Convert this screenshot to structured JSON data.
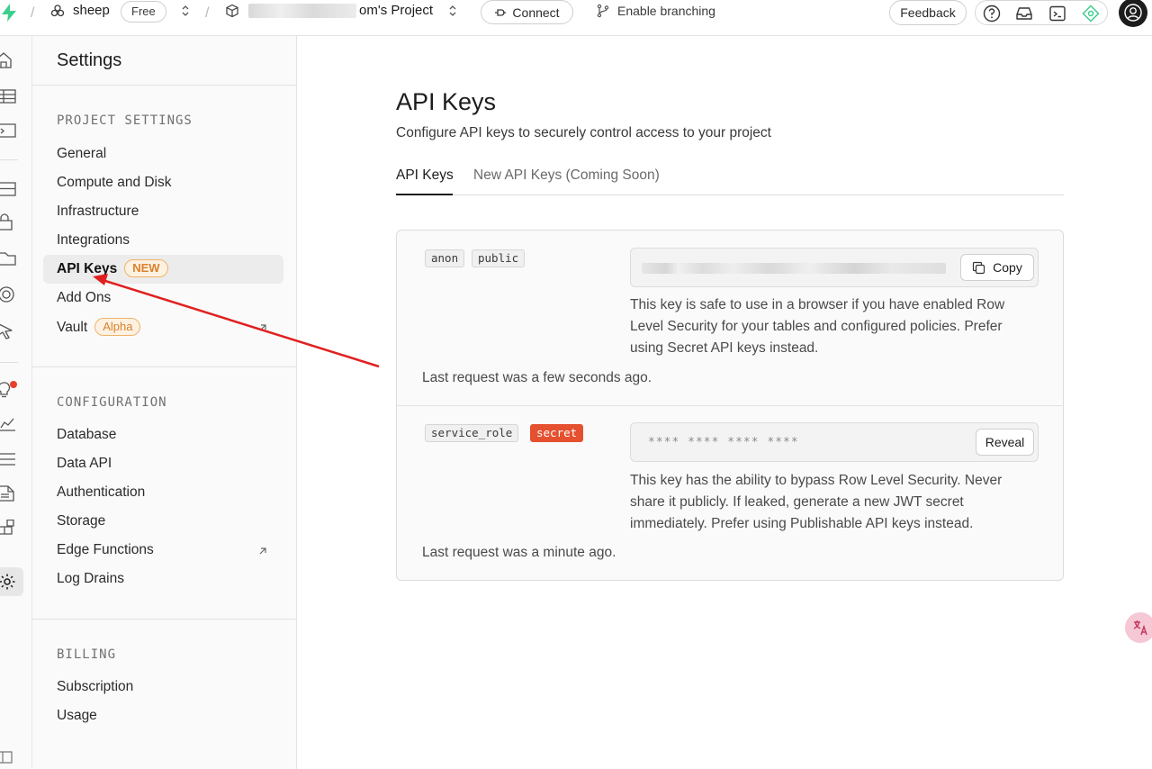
{
  "topbar": {
    "org_name": "sheep",
    "plan": "Free",
    "project_name": "om's Project",
    "connect_label": "Connect",
    "branching_label": "Enable branching",
    "feedback_label": "Feedback",
    "separator": "/"
  },
  "sidebar": {
    "title": "Settings",
    "sections": [
      {
        "heading": "PROJECT SETTINGS",
        "items": [
          "General",
          "Compute and Disk",
          "Infrastructure",
          "Integrations",
          "API Keys",
          "Add Ons",
          "Vault"
        ]
      },
      {
        "heading": "CONFIGURATION",
        "items": [
          "Database",
          "Data API",
          "Authentication",
          "Storage",
          "Edge Functions",
          "Log Drains"
        ]
      },
      {
        "heading": "BILLING",
        "items": [
          "Subscription",
          "Usage"
        ]
      }
    ],
    "badge_new": "NEW",
    "badge_alpha": "Alpha"
  },
  "main": {
    "title": "API Keys",
    "subtitle": "Configure API keys to securely control access to your project",
    "tabs": [
      "API Keys",
      "New API Keys (Coming Soon)"
    ],
    "keys": [
      {
        "tags": [
          "anon",
          "public"
        ],
        "button": "Copy",
        "description": "This key is safe to use in a browser if you have enabled Row Level Security for your tables and configured policies. Prefer using Secret API keys instead.",
        "last_request": "Last request was a few seconds ago."
      },
      {
        "tags": [
          "service_role",
          "secret"
        ],
        "masked_value": "**** **** **** ****",
        "button": "Reveal",
        "description": "This key has the ability to bypass Row Level Security. Never share it publicly. If leaked, generate a new JWT secret immediately. Prefer using Publishable API keys instead.",
        "last_request": "Last request was a minute ago."
      }
    ]
  },
  "colors": {
    "brand": "#3ecf8e",
    "secret_tag": "#e5502f",
    "annotation_arrow": "#e02020",
    "badge_orange": "#d9822b"
  },
  "icons": [
    "supabase-logo-icon",
    "org-icon",
    "project-cube-icon",
    "plug-icon",
    "branch-icon",
    "help-icon",
    "inbox-icon",
    "terminal-icon",
    "advisor-icon",
    "home-icon",
    "table-icon",
    "sql-icon",
    "database-icon",
    "auth-icon",
    "storage-icon",
    "realtime-icon",
    "edge-functions-icon",
    "advisors-icon",
    "reports-icon",
    "logs-icon",
    "api-docs-icon",
    "integrations-icon",
    "settings-icon",
    "external-link-icon",
    "copy-icon",
    "translate-icon"
  ]
}
